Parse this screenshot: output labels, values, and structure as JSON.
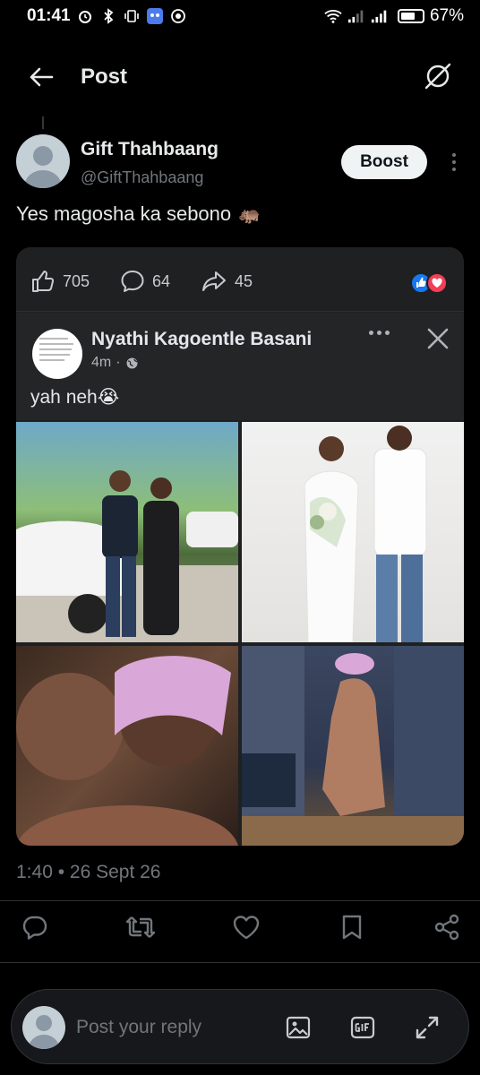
{
  "status_bar": {
    "time": "01:41",
    "battery_percent": "67%",
    "battery_level": 0.67
  },
  "header": {
    "title": "Post"
  },
  "tweet": {
    "author_name": "Gift Thahbaang",
    "author_handle": "@GiftThahbaang",
    "boost_label": "Boost",
    "text": "Yes magosha ka sebono",
    "emoji": "🦛",
    "timestamp": "1:40 • 26 Sept 26"
  },
  "embedded_card": {
    "likes": "705",
    "comments": "64",
    "shares": "45",
    "post": {
      "author": "Nyathi Kagoentle Basani",
      "time": "4m",
      "text": "yah neh",
      "emoji": "😭"
    }
  },
  "actions": [
    "reply-icon",
    "retweet-icon",
    "like-icon",
    "bookmark-icon",
    "share-icon"
  ],
  "reply_bar": {
    "placeholder": "Post your reply"
  },
  "colors": {
    "background": "#000000",
    "text_primary": "#e7e9ea",
    "text_secondary": "#71767b",
    "card_bg": "#1f2021",
    "fb_like_blue": "#1877f2",
    "fb_love_red": "#f33e58"
  }
}
